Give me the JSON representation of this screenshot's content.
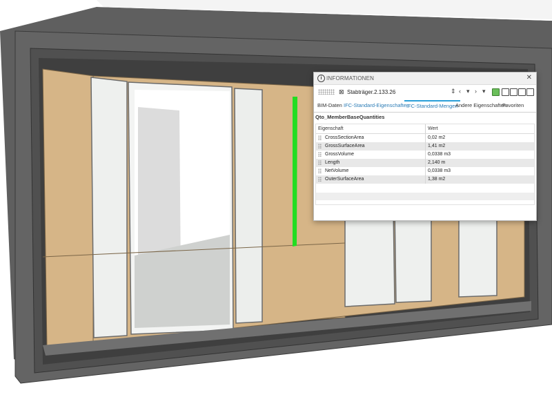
{
  "window": {
    "title": "INFORMATIONEN",
    "close_symbol": "✕"
  },
  "object": {
    "name": "Stabträger.2.133.26",
    "icon": "member-icon"
  },
  "toolbar": {
    "icons": [
      "updown-arrows-icon",
      "prev-icon",
      "dropdown-icon",
      "next-icon",
      "dropdown-icon",
      "filter-icon",
      "clipboard-icon",
      "clipboard-icon",
      "clipboard-icon",
      "window-icon"
    ]
  },
  "tabs": [
    {
      "label": "BIM-Daten"
    },
    {
      "label": "IFC-Standard-Eigenschaften"
    },
    {
      "label": "IFC-Standard-Mengen"
    },
    {
      "label": "Andere Eigenschaften"
    },
    {
      "label": "Favoriten"
    }
  ],
  "section": {
    "title": "Qto_MemberBaseQuantities"
  },
  "grid": {
    "headers": {
      "property": "Eigenschaft",
      "value": "Wert"
    },
    "rows": [
      {
        "name": "CrossSectionArea",
        "value": "0,02 m2"
      },
      {
        "name": "GrossSurfaceArea",
        "value": "1,41 m2"
      },
      {
        "name": "GrossVolume",
        "value": "0,0338 m3"
      },
      {
        "name": "Length",
        "value": "2,140 m"
      },
      {
        "name": "NetVolume",
        "value": "0,0338 m3"
      },
      {
        "name": "OuterSurfaceArea",
        "value": "1,38 m2"
      }
    ]
  },
  "colors": {
    "highlight": "#22dd22",
    "wood": "#d6b587",
    "wall": "#5d5d5d",
    "accent": "#2a9fd8"
  }
}
